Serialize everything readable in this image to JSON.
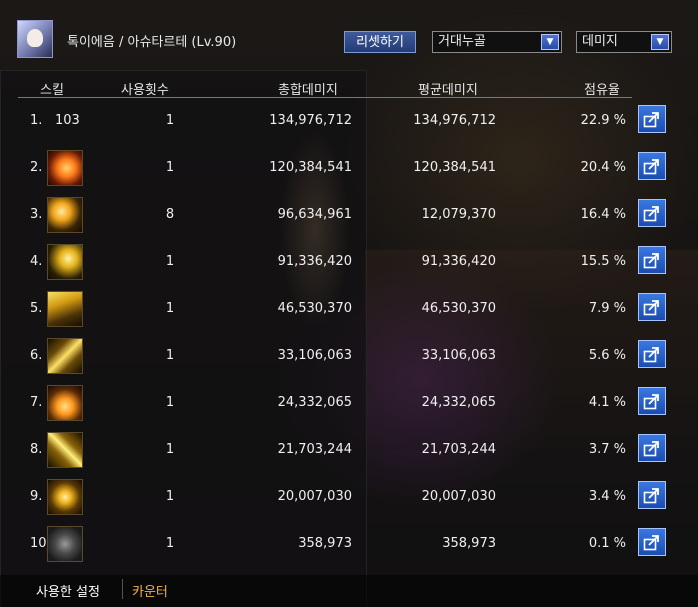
{
  "header": {
    "title": "톡이에음 / 아슈타르테 (Lv.90)",
    "reset_label": "리셋하기",
    "boss_select": "거대누골",
    "metric_select": "데미지"
  },
  "table": {
    "columns": [
      "스킬",
      "사용횟수",
      "총합데미지",
      "평균데미지",
      "점유율"
    ],
    "rows": [
      {
        "num": "1.",
        "icon_label": "103",
        "icon": "no-icon",
        "count": "1",
        "total": "134,976,712",
        "avg": "134,976,712",
        "share": "22.9 %"
      },
      {
        "num": "2.",
        "icon_label": "",
        "icon": "sun-burst-skill-icon",
        "count": "1",
        "total": "120,384,541",
        "avg": "120,384,541",
        "share": "20.4 %"
      },
      {
        "num": "3.",
        "icon_label": "",
        "icon": "orb-spiral-skill-icon",
        "count": "8",
        "total": "96,634,961",
        "avg": "12,079,370",
        "share": "16.4 %"
      },
      {
        "num": "4.",
        "icon_label": "",
        "icon": "crescent-skill-icon",
        "count": "1",
        "total": "91,336,420",
        "avg": "91,336,420",
        "share": "15.5 %"
      },
      {
        "num": "5.",
        "icon_label": "",
        "icon": "wave-slash-skill-icon",
        "count": "1",
        "total": "46,530,370",
        "avg": "46,530,370",
        "share": "7.9 %"
      },
      {
        "num": "6.",
        "icon_label": "",
        "icon": "beam-skill-icon",
        "count": "1",
        "total": "33,106,063",
        "avg": "33,106,063",
        "share": "5.6 %"
      },
      {
        "num": "7.",
        "icon_label": "",
        "icon": "flame-skill-icon",
        "count": "1",
        "total": "24,332,065",
        "avg": "24,332,065",
        "share": "4.1 %"
      },
      {
        "num": "8.",
        "icon_label": "",
        "icon": "lightning-skill-icon",
        "count": "1",
        "total": "21,703,244",
        "avg": "21,703,244",
        "share": "3.7 %"
      },
      {
        "num": "9.",
        "icon_label": "",
        "icon": "vortex-skill-icon",
        "count": "1",
        "total": "20,007,030",
        "avg": "20,007,030",
        "share": "3.4 %"
      },
      {
        "num": "10.",
        "icon_label": "",
        "icon": "gear-skill-icon",
        "count": "1",
        "total": "358,973",
        "avg": "358,973",
        "share": "0.1 %"
      }
    ]
  },
  "footer": {
    "settings_tab": "사용한 설정",
    "counter_tab": "카운터"
  },
  "colors": {
    "accent_blue": "#2a5cc8",
    "counter_orange": "#f2b24a"
  }
}
